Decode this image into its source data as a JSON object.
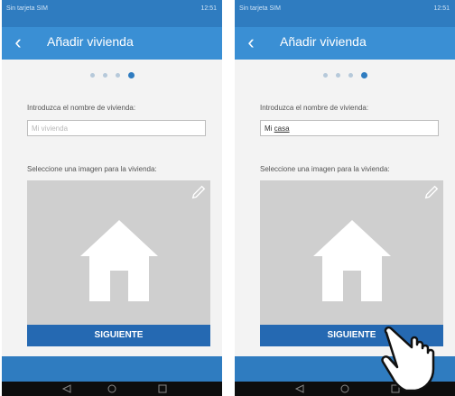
{
  "screens": [
    {
      "status": {
        "carrier": "Sin tarjeta SIM",
        "right": "12:51"
      },
      "app_bar": {
        "title": "Añadir vivienda"
      },
      "steps": {
        "total": 4,
        "active_index": 4
      },
      "name_field": {
        "label": "Introduzca el nombre de vivienda:",
        "placeholder": "Mi vivienda",
        "value": ""
      },
      "image_section": {
        "label": "Seleccione una imagen para la vivienda:"
      },
      "next_button": {
        "label": "SIGUIENTE"
      }
    },
    {
      "status": {
        "carrier": "Sin tarjeta SIM",
        "right": "12:51"
      },
      "app_bar": {
        "title": "Añadir vivienda"
      },
      "steps": {
        "total": 4,
        "active_index": 4
      },
      "name_field": {
        "label": "Introduzca el nombre de vivienda:",
        "placeholder": "Mi vivienda",
        "value_prefix": "Mi ",
        "value_underlined": "casa"
      },
      "image_section": {
        "label": "Seleccione una imagen para la vivienda:"
      },
      "next_button": {
        "label": "SIGUIENTE"
      }
    }
  ],
  "icons": {
    "back": "back-arrow-icon",
    "edit": "pencil-icon",
    "house": "house-icon",
    "nav": [
      "back-triangle-icon",
      "home-circle-icon",
      "recent-square-icon"
    ],
    "pointer": "hand-pointer-icon"
  },
  "colors": {
    "status_bar": "#2f7cc0",
    "app_bar": "#3a8fd4",
    "button": "#2569b2",
    "image_placeholder": "#cfcfcf"
  }
}
